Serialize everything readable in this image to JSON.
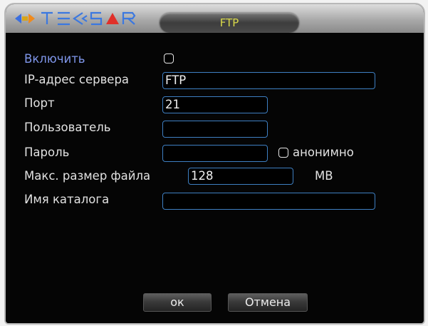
{
  "titlebar": {
    "logo_text": "TE<SAR",
    "tab_title": "FTP"
  },
  "form": {
    "enable_label": "Включить",
    "enable_checked": false,
    "server_label": "IP-адрес сервера",
    "server_value": "FTP",
    "port_label": "Порт",
    "port_value": "21",
    "user_label": "Пользователь",
    "user_value": "",
    "password_label": "Пароль",
    "password_value": "",
    "anonymous_label": "анонимно",
    "anonymous_checked": false,
    "max_size_label": "Макс. размер файла",
    "max_size_value": "128",
    "max_size_unit": "MB",
    "catalog_label": "Имя каталога",
    "catalog_value": ""
  },
  "buttons": {
    "ok_label": "ок",
    "cancel_label": "Отмена"
  },
  "colors": {
    "accent_blue": "#3e7fc2",
    "title_yellow": "#d9d94a",
    "enable_label_color": "#7f96ea",
    "logo_red": "#e0302a"
  }
}
